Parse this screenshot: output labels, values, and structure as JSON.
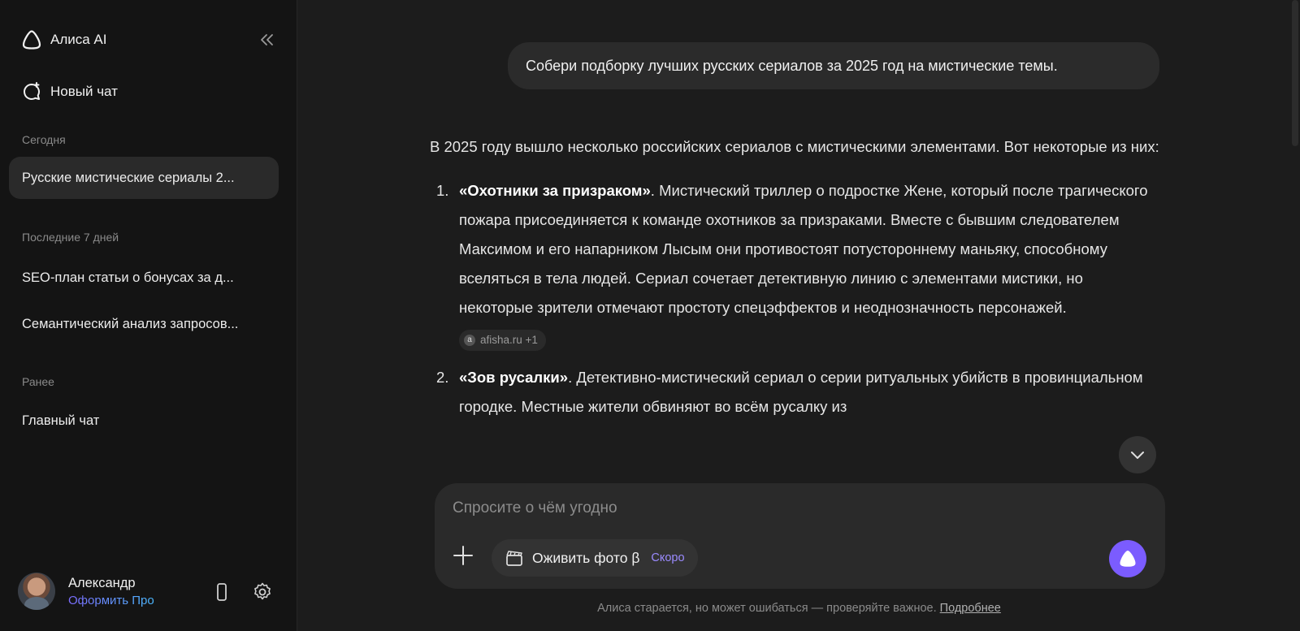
{
  "sidebar": {
    "brand": "Алиса AI",
    "new_chat": "Новый чат",
    "sections": [
      {
        "title": "Сегодня",
        "items": [
          "Русские мистические сериалы 2..."
        ]
      },
      {
        "title": "Последние 7 дней",
        "items": [
          "SEO-план статьи о бонусах за д...",
          "Семантический анализ запросов..."
        ]
      },
      {
        "title": "Ранее",
        "items": [
          "Главный чат"
        ]
      }
    ],
    "user": {
      "name": "Александр",
      "plan_link": "Оформить Про"
    }
  },
  "chat": {
    "user_message": "Собери подборку лучших русских сериалов за 2025 год на мистические темы.",
    "intro": "В 2025 году вышло несколько российских сериалов с мистическими элементами. Вот некоторые из них:",
    "items": [
      {
        "num": "1.",
        "title": "«Охотники за призраком»",
        "text": ". Мистический триллер о подростке Жене, который после трагического пожара присоединяется к команде охотников за призраками. Вместе с бывшим следователем Максимом и его напарником Лысым они противостоят потустороннему маньяку, способному вселяться в тела людей. Сериал сочетает детективную линию с элементами мистики, но некоторые зрители отмечают простоту спецэффектов и неоднозначность персонажей.",
        "source": "afisha.ru +1"
      },
      {
        "num": "2.",
        "title": "«Зов русалки»",
        "text": ". Детективно-мистический сериал о серии ритуальных убийств в провинциальном городке. Местные жители обвиняют во всём русалку из"
      }
    ]
  },
  "composer": {
    "placeholder": "Спросите о чём угодно",
    "chip_label": "Оживить фото β",
    "chip_badge": "Скоро"
  },
  "footer": {
    "disclaimer": "Алиса старается, но может ошибаться — проверяйте важное.",
    "more_link": "Подробнее"
  },
  "colors": {
    "accent": "#7b5cff",
    "sidebar_bg": "#141414",
    "main_bg": "#1c1c1c"
  }
}
